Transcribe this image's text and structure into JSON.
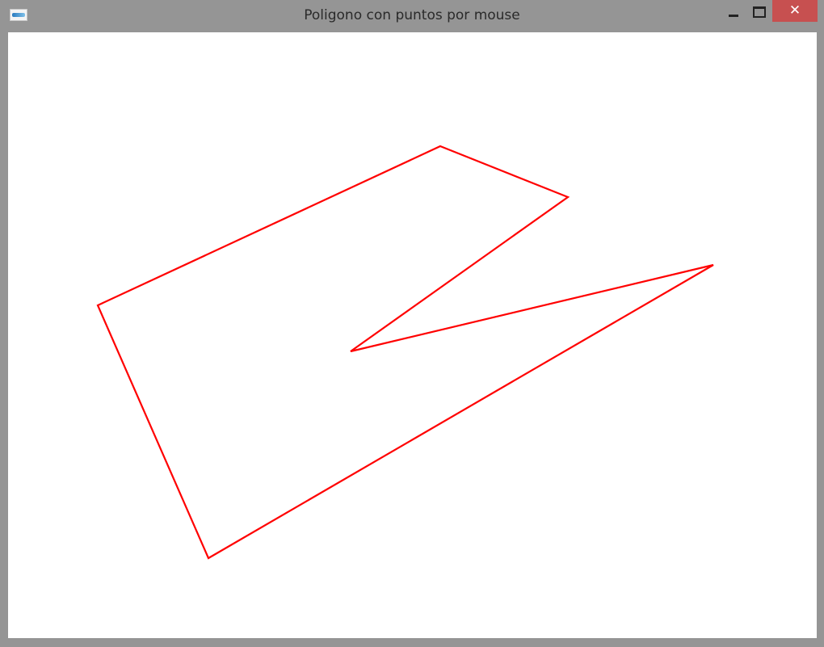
{
  "window": {
    "title": "Poligono con puntos por mouse",
    "close_glyph": "✕"
  },
  "icons": {
    "app": "app-icon",
    "minimize": "minimize-icon",
    "maximize": "maximize-icon",
    "close": "close-icon"
  },
  "colors": {
    "polygon_stroke": "#ff0000",
    "canvas_bg": "#ffffff",
    "close_button": "#c75050",
    "frame": "#959595"
  }
}
